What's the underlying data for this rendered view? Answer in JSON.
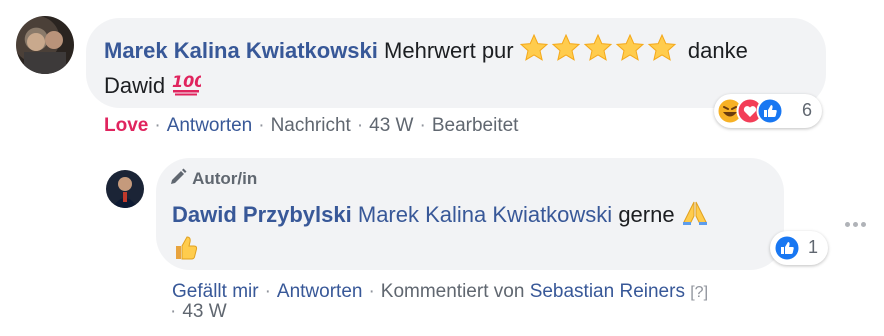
{
  "comment": {
    "author": "Marek Kalina Kwiatkowski",
    "text_line1": "Mehrwert pur",
    "text_after_stars": "danke",
    "text_line2": "Dawid",
    "stars_count": 5,
    "reactions": {
      "count": "6",
      "icons": [
        "haha-icon",
        "love-icon",
        "like-icon"
      ]
    },
    "actions": {
      "love": "Love",
      "reply": "Antworten",
      "message": "Nachricht",
      "time": "43 W",
      "edited": "Bearbeitet"
    }
  },
  "reply": {
    "author_badge": "Autor/in",
    "author": "Dawid Przybylski",
    "mention": "Marek Kalina Kwiatkowski",
    "text": "gerne",
    "reactions": {
      "count": "1",
      "icons": [
        "like-icon"
      ]
    },
    "actions": {
      "like": "Gefällt mir",
      "reply": "Antworten",
      "commented_by_prefix": "Kommentiert von",
      "commented_by_name": "Sebastian Reiners",
      "help": "[?]",
      "time": "43 W"
    }
  },
  "colors": {
    "link": "#385898",
    "love": "#e0245e",
    "bubble": "#f2f3f5",
    "like_blue": "#1877f2",
    "love_red": "#f33e58",
    "haha_yellow": "#f7b125",
    "star": "#ffcc4d"
  }
}
